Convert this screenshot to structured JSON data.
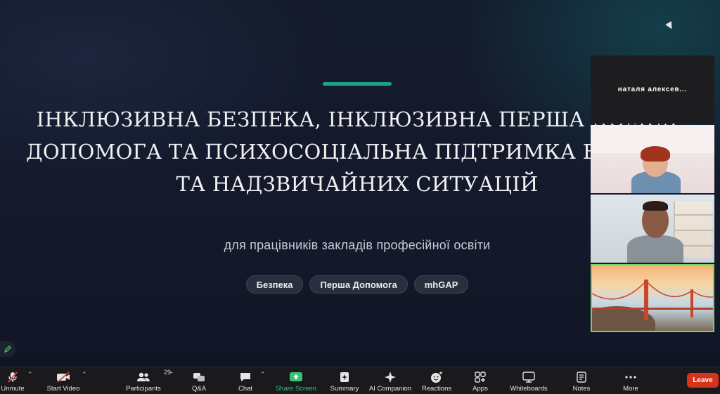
{
  "slide": {
    "title_lines": [
      "ІНКЛЮЗИВНА БЕЗПЕКА, ІНКЛЮЗИВНА ПЕРША ДОМЕД",
      "ДОПОМОГА ТА ПСИХОСОЦІАЛЬНА ПІДТРИМКА В УМОВА",
      "ТА НАДЗВИЧАЙНИХ СИТУАЦІЙ"
    ],
    "subtitle": "для працівників закладів професійної освіти",
    "tags": [
      "Безпека",
      "Перша Допомога",
      "mhGAP"
    ]
  },
  "participants": {
    "name_tile": "наталя алексев..."
  },
  "toolbar": {
    "unmute": "Unmute",
    "start_video": "Start Video",
    "participants": "Participants",
    "participants_count": "29",
    "qa": "Q&A",
    "chat": "Chat",
    "share_screen": "Share Screen",
    "summary": "Summary",
    "ai_companion": "AI Companion",
    "reactions": "Reactions",
    "apps": "Apps",
    "whiteboards": "Whiteboards",
    "notes": "Notes",
    "more": "More",
    "leave": "Leave"
  },
  "colors": {
    "accent_teal": "#1fa08e",
    "share_green": "#38c172",
    "leave_red": "#d6321c",
    "mute_red": "#e5413a"
  }
}
